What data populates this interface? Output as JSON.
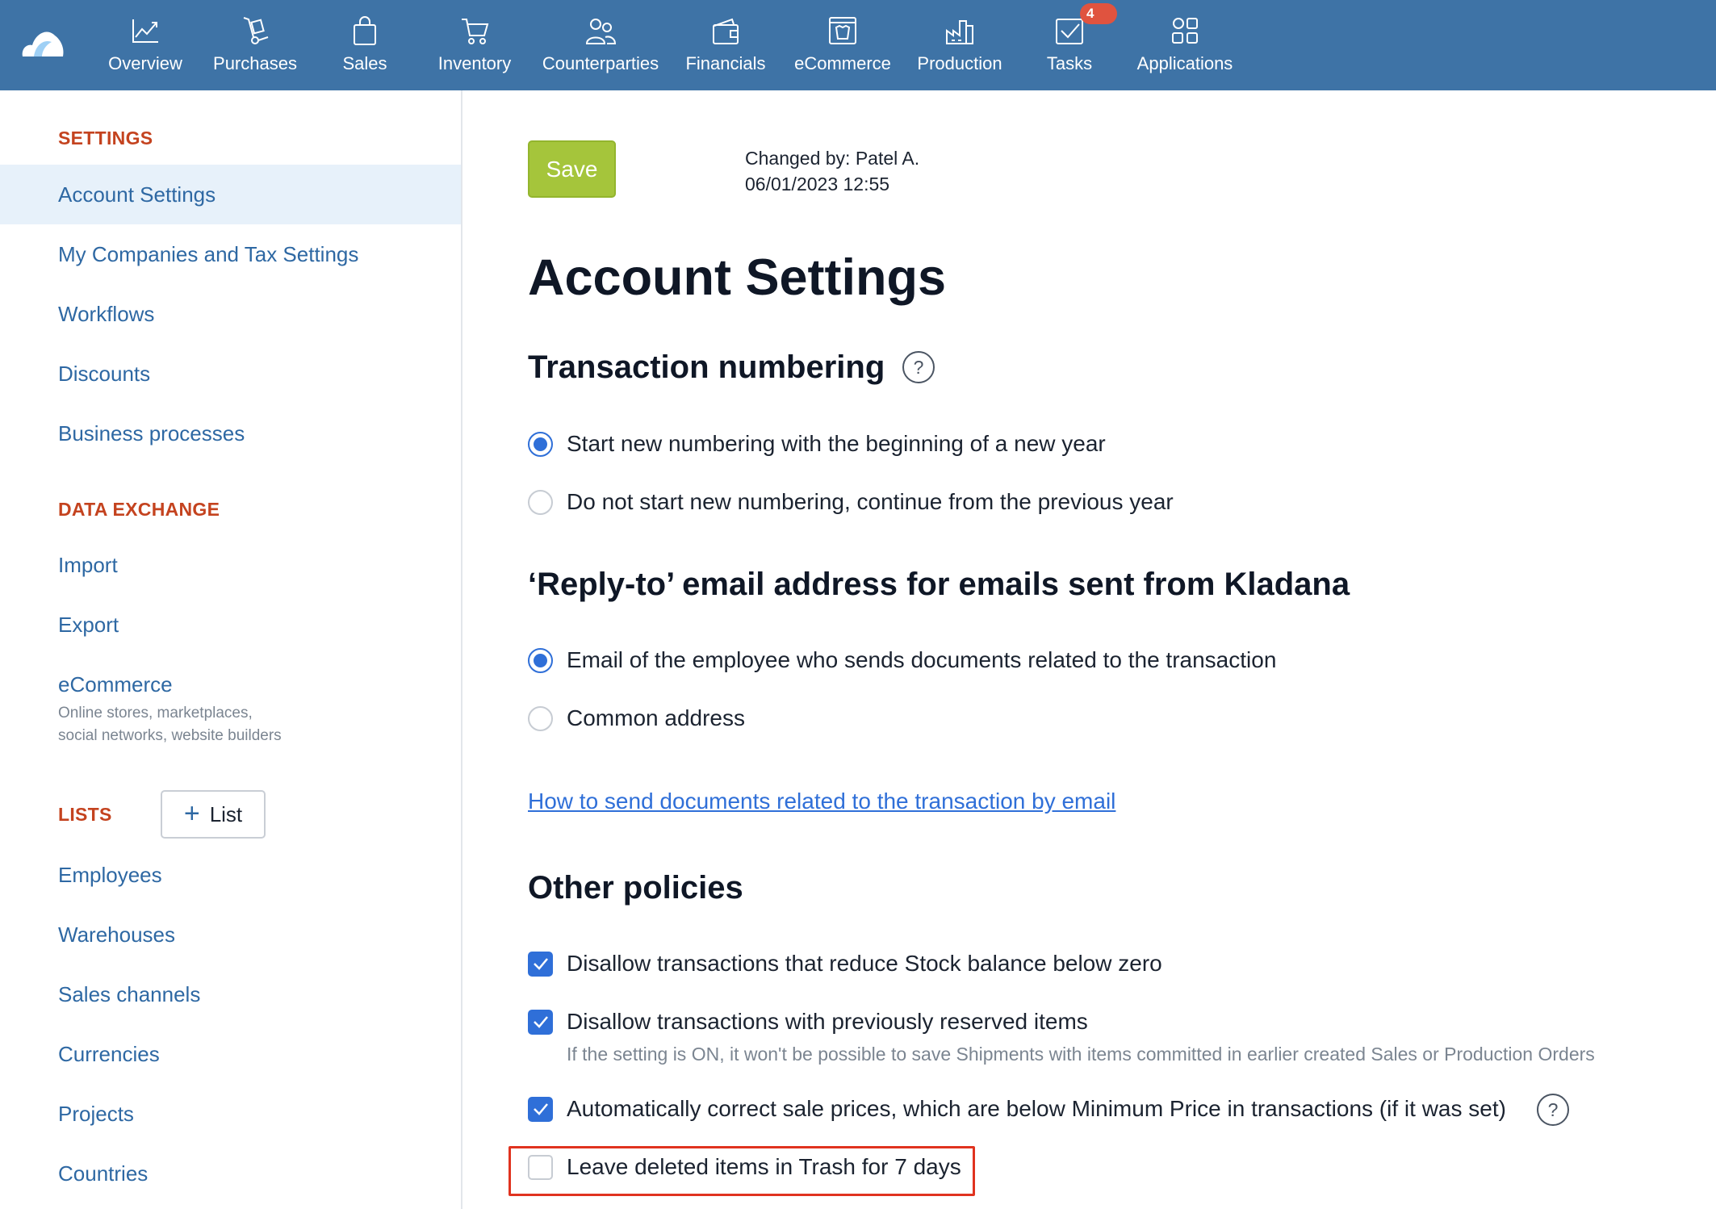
{
  "nav": {
    "items": [
      {
        "label": "Overview",
        "icon": "chart-line-icon"
      },
      {
        "label": "Purchases",
        "icon": "hand-truck-icon"
      },
      {
        "label": "Sales",
        "icon": "shopping-bag-icon"
      },
      {
        "label": "Inventory",
        "icon": "cart-icon"
      },
      {
        "label": "Counterparties",
        "icon": "people-icon"
      },
      {
        "label": "Financials",
        "icon": "wallet-icon"
      },
      {
        "label": "eCommerce",
        "icon": "storefront-icon"
      },
      {
        "label": "Production",
        "icon": "factory-icon"
      },
      {
        "label": "Tasks",
        "icon": "task-check-icon"
      },
      {
        "label": "Applications",
        "icon": "apps-grid-icon"
      }
    ],
    "tasks_badge": "4"
  },
  "sidebar": {
    "settings_heading": "SETTINGS",
    "settings_items": [
      "Account Settings",
      "My Companies and Tax Settings",
      "Workflows",
      "Discounts",
      "Business processes"
    ],
    "active_item": "Account Settings",
    "data_exchange_heading": "DATA EXCHANGE",
    "data_exchange_items": [
      "Import",
      "Export",
      "eCommerce"
    ],
    "ecommerce_sub": [
      "Online stores, marketplaces,",
      "social networks, website builders"
    ],
    "lists_heading": "LISTS",
    "list_button_label": "List",
    "lists_items": [
      "Employees",
      "Warehouses",
      "Sales channels",
      "Currencies",
      "Projects",
      "Countries"
    ]
  },
  "main": {
    "save_label": "Save",
    "changed_by": "Changed by: Patel A.",
    "changed_at": "06/01/2023 12:55",
    "title": "Account Settings",
    "numbering": {
      "title": "Transaction numbering",
      "options": [
        {
          "label": "Start new numbering with the beginning of a new year",
          "selected": true
        },
        {
          "label": "Do not start new numbering, continue from the previous year",
          "selected": false
        }
      ]
    },
    "reply_to": {
      "title": "‘Reply-to’ email address for emails sent from Kladana",
      "options": [
        {
          "label": "Email of the employee who sends documents related to the transaction",
          "selected": true
        },
        {
          "label": "Common address",
          "selected": false
        }
      ],
      "help_link": "How to send documents related to the transaction by email"
    },
    "policies": {
      "title": "Other policies",
      "items": [
        {
          "label": "Disallow transactions that reduce Stock balance below zero",
          "checked": true
        },
        {
          "label": "Disallow transactions with previously reserved items",
          "checked": true
        },
        {
          "label": "Automatically correct sale prices, which are below Minimum Price in transactions (if it was set)",
          "checked": true
        },
        {
          "label": "Leave deleted items in Trash for 7 days",
          "checked": false
        }
      ],
      "reserved_hint": "If the setting is ON, it won't be possible to save Shipments with items committed in earlier created Sales or Production Orders"
    }
  },
  "colors": {
    "topbar": "#3e73a6",
    "accent_blue": "#2f6fd8",
    "heading_orange": "#c4431f",
    "save_green": "#a5c53b",
    "badge_red": "#e0533f",
    "highlight_red": "#e0331f"
  }
}
